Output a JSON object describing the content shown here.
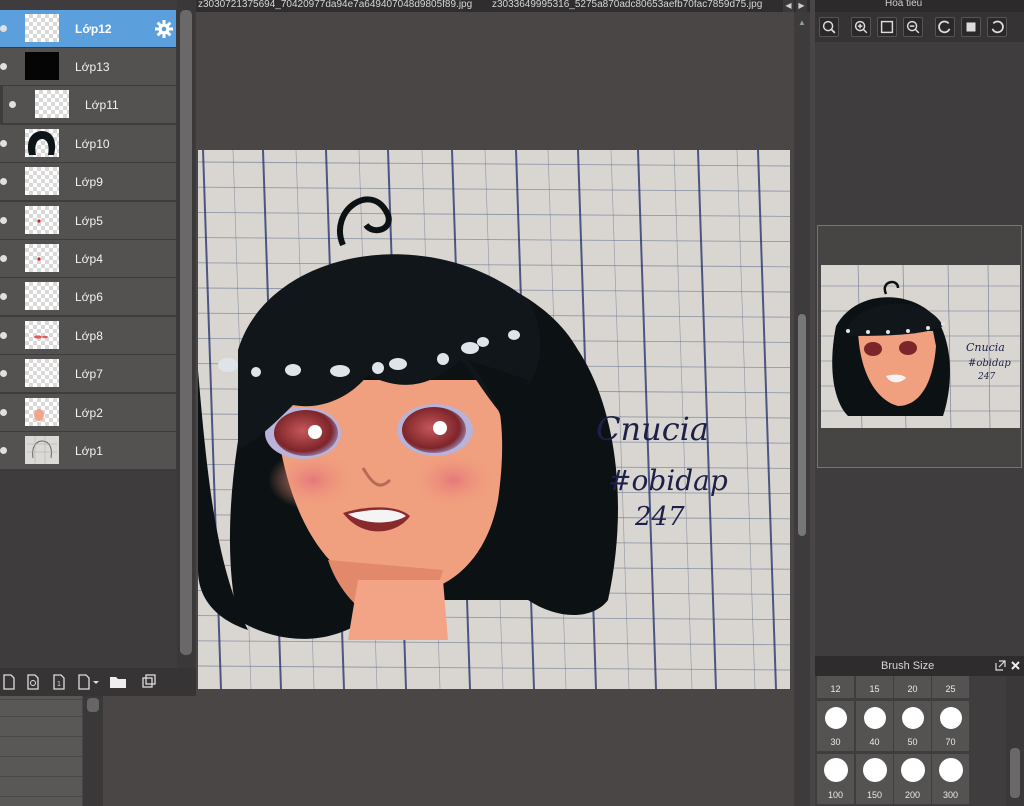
{
  "tabs": {
    "file1": "z3030721375694_70420977da94e7a649407048d9805f89.jpg",
    "file2": "z3033649995316_5275a870adc80653aefb70fac7859d75.jpg",
    "prev_icon": "triangle-left-icon",
    "next_icon": "triangle-right-icon"
  },
  "layers": [
    {
      "name": "Lớp12",
      "thumb": "transparent",
      "selected": true
    },
    {
      "name": "Lớp13",
      "thumb": "black"
    },
    {
      "name": "Lớp11",
      "thumb": "transparent"
    },
    {
      "name": "Lớp10",
      "thumb": "hair"
    },
    {
      "name": "Lớp9",
      "thumb": "transparent"
    },
    {
      "name": "Lớp5",
      "thumb": "dot"
    },
    {
      "name": "Lớp4",
      "thumb": "dot"
    },
    {
      "name": "Lớp6",
      "thumb": "transparent"
    },
    {
      "name": "Lớp8",
      "thumb": "lips"
    },
    {
      "name": "Lớp7",
      "thumb": "transparent"
    },
    {
      "name": "Lớp2",
      "thumb": "skin"
    },
    {
      "name": "Lớp1",
      "thumb": "sketch"
    }
  ],
  "layer_tools": [
    "new-layer-icon",
    "new-halftone-layer-icon",
    "new-1bit-layer-icon",
    "new-raster-dropdown-icon",
    "new-folder-icon",
    "duplicate-layer-icon"
  ],
  "navigator": {
    "title": "Hoa tieu",
    "buttons": [
      "zoom-actual-icon",
      "zoom-in-icon",
      "fit-icon",
      "zoom-out-icon",
      "rotate-left-icon",
      "fit-window-icon",
      "rotate-right-icon"
    ]
  },
  "artwork": {
    "signature": "Cnucia",
    "hashtag": "#obidap",
    "number": "247"
  },
  "brush": {
    "title": "Brush Size",
    "sizes": [
      "12",
      "15",
      "20",
      "25",
      "30",
      "40",
      "50",
      "70",
      "100",
      "150",
      "200",
      "300"
    ]
  },
  "colors": {
    "selected_layer": "#5b9fdc",
    "panel_bg": "#3e3c3c",
    "canvas_bg": "#4a4646",
    "preview_frame": "#e04848"
  }
}
